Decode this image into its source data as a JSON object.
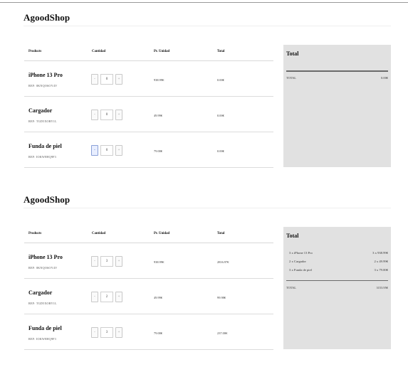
{
  "sections": [
    {
      "brand": "AgoodShop",
      "columns": {
        "product": "Products",
        "quantity": "Cantidad",
        "unit_price": "Pr. Unidad",
        "total": "Total"
      },
      "products": [
        {
          "name": "iPhone 13 Pro",
          "ref": "REF: 0KNQO6OY4V",
          "qty": "0",
          "unit_price": "938.99€",
          "total": "0.00€",
          "minus": "-",
          "plus": "+"
        },
        {
          "name": "Cargador",
          "ref": "REF: TGD5XORY1L",
          "qty": "0",
          "unit_price": "49.99€",
          "total": "0.00€",
          "minus": "-",
          "plus": "+"
        },
        {
          "name": "Funda de piel",
          "ref": "REF: IOKW8HQ9F3",
          "qty": "0",
          "unit_price": "79.00€",
          "total": "0.00€",
          "minus": "-",
          "plus": "+"
        }
      ],
      "summary": {
        "title": "Total",
        "items": [],
        "total_label": "TOTAL",
        "total_value": "0.00€"
      }
    },
    {
      "brand": "AgoodShop",
      "columns": {
        "product": "Products",
        "quantity": "Cantidad",
        "unit_price": "Pr. Unidad",
        "total": "Total"
      },
      "products": [
        {
          "name": "iPhone 13 Pro",
          "ref": "REF: 0KNQO6OY4V",
          "qty": "3",
          "unit_price": "938.99€",
          "total": "2816.97€",
          "minus": "-",
          "plus": "+"
        },
        {
          "name": "Cargador",
          "ref": "REF: TGD5XORY1L",
          "qty": "2",
          "unit_price": "49.99€",
          "total": "99.98€",
          "minus": "-",
          "plus": "+"
        },
        {
          "name": "Funda de piel",
          "ref": "REF: IOKW8HQ9F3",
          "qty": "3",
          "unit_price": "79.00€",
          "total": "237.00€",
          "minus": "-",
          "plus": "+"
        }
      ],
      "summary": {
        "title": "Total",
        "items": [
          {
            "label": "3 x iPhone 13 Pro",
            "value": "3 x 938.99€"
          },
          {
            "label": "2 x Cargador",
            "value": "2 x 49.99€"
          },
          {
            "label": "3 x Funda de piel",
            "value": "3 x 79.00€"
          }
        ],
        "total_label": "TOTAL",
        "total_value": "3153.95€"
      }
    }
  ]
}
